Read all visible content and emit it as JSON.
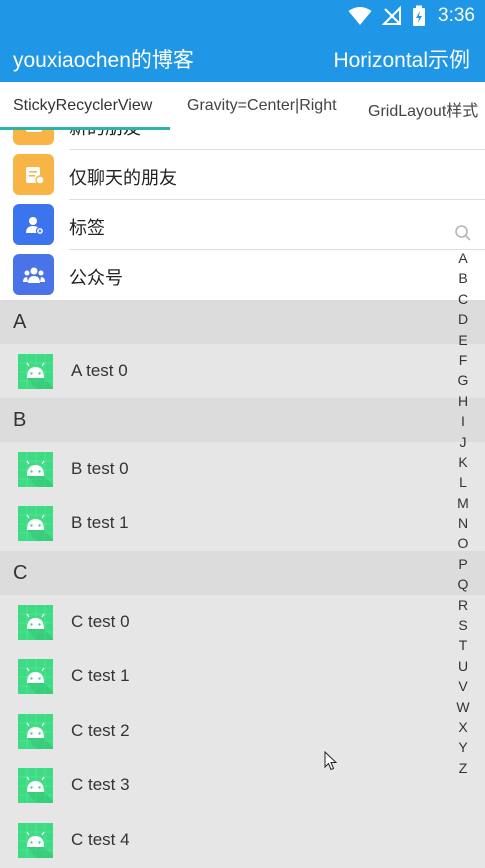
{
  "status_bar": {
    "time": "3:36"
  },
  "app_bar": {
    "title": "youxiaochen的博客",
    "action": "Horizontal示例"
  },
  "tabs": [
    {
      "label": "StickyRecyclerView"
    },
    {
      "label": "Gravity=Center|Right"
    },
    {
      "label": "GridLayout样式"
    }
  ],
  "header_items": [
    {
      "label": "新的朋友",
      "icon": "person-add-icon",
      "color": "#f8b545"
    },
    {
      "label": "仅聊天的朋友",
      "icon": "chat-card-icon",
      "color": "#f8b545"
    },
    {
      "label": "标签",
      "icon": "tag-user-icon",
      "color": "#3c74ee"
    },
    {
      "label": "公众号",
      "icon": "group-icon",
      "color": "#4a73e8"
    }
  ],
  "sections": [
    {
      "letter": "A",
      "items": [
        "A test 0"
      ]
    },
    {
      "letter": "B",
      "items": [
        "B test 0",
        "B test 1"
      ]
    },
    {
      "letter": "C",
      "items": [
        "C test 0",
        "C test 1",
        "C test 2",
        "C test 3",
        "C test 4"
      ]
    }
  ],
  "index_letters": [
    "A",
    "B",
    "C",
    "D",
    "E",
    "F",
    "G",
    "H",
    "I",
    "J",
    "K",
    "L",
    "M",
    "N",
    "O",
    "P",
    "Q",
    "R",
    "S",
    "T",
    "U",
    "V",
    "W",
    "X",
    "Y",
    "Z"
  ],
  "colors": {
    "primary": "#1f97e6",
    "accent": "#2bb3a8",
    "android_green": "#3ddc84"
  }
}
